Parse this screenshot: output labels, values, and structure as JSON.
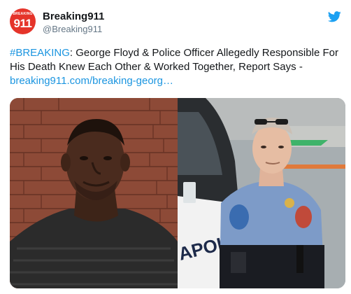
{
  "account": {
    "name": "Breaking911",
    "handle": "@Breaking911",
    "avatar_text_small": "BREAKING",
    "avatar_text_big": "911"
  },
  "tweet": {
    "hashtag": "#BREAKING",
    "body": ": George Floyd & Police Officer Allegedly Responsible For His Death Knew Each Other & Worked Together, Report Says - ",
    "link": "breaking911.com/breaking-georg…"
  },
  "media": {
    "right_photo_car_text": "APOLIS"
  },
  "colors": {
    "brand_red": "#e5342a",
    "link_blue": "#1b95e0",
    "twitter_blue": "#1da1f2"
  },
  "icons": {
    "twitter": "twitter-bird-icon"
  }
}
